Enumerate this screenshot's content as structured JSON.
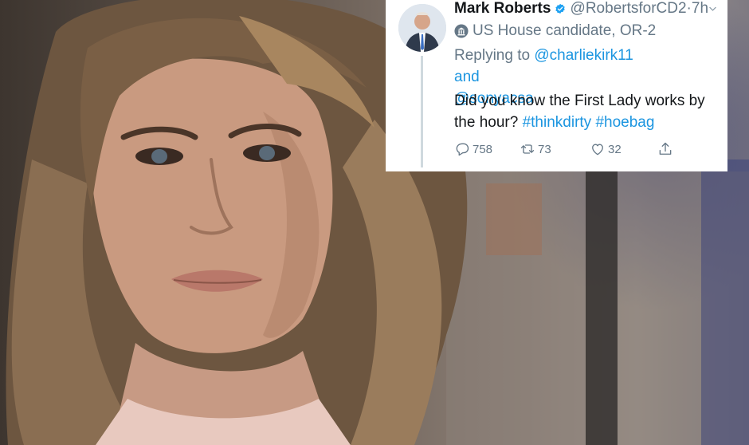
{
  "background": {
    "description_icon": "photo-of-woman"
  },
  "tweet": {
    "display_name": "Mark Roberts",
    "handle": "@RobertsforCD2",
    "separator": "·",
    "time": "7h",
    "label": "US House candidate, OR-2",
    "replying_prefix": "Replying to",
    "reply_to_1": "@charliekirk11",
    "reply_conjunction": "and",
    "reply_to_2": "@sonyacsa",
    "text_plain": "Did you know the First Lady works by the hour?",
    "hashtag_1": "#thinkdirty",
    "hashtag_2": "#hoebag",
    "reply_count": "758",
    "retweet_count": "73",
    "like_count": "32"
  },
  "colors": {
    "link": "#1b95e0",
    "secondary_text": "#657786",
    "primary_text": "#14171a",
    "verified": "#1da1f2"
  }
}
